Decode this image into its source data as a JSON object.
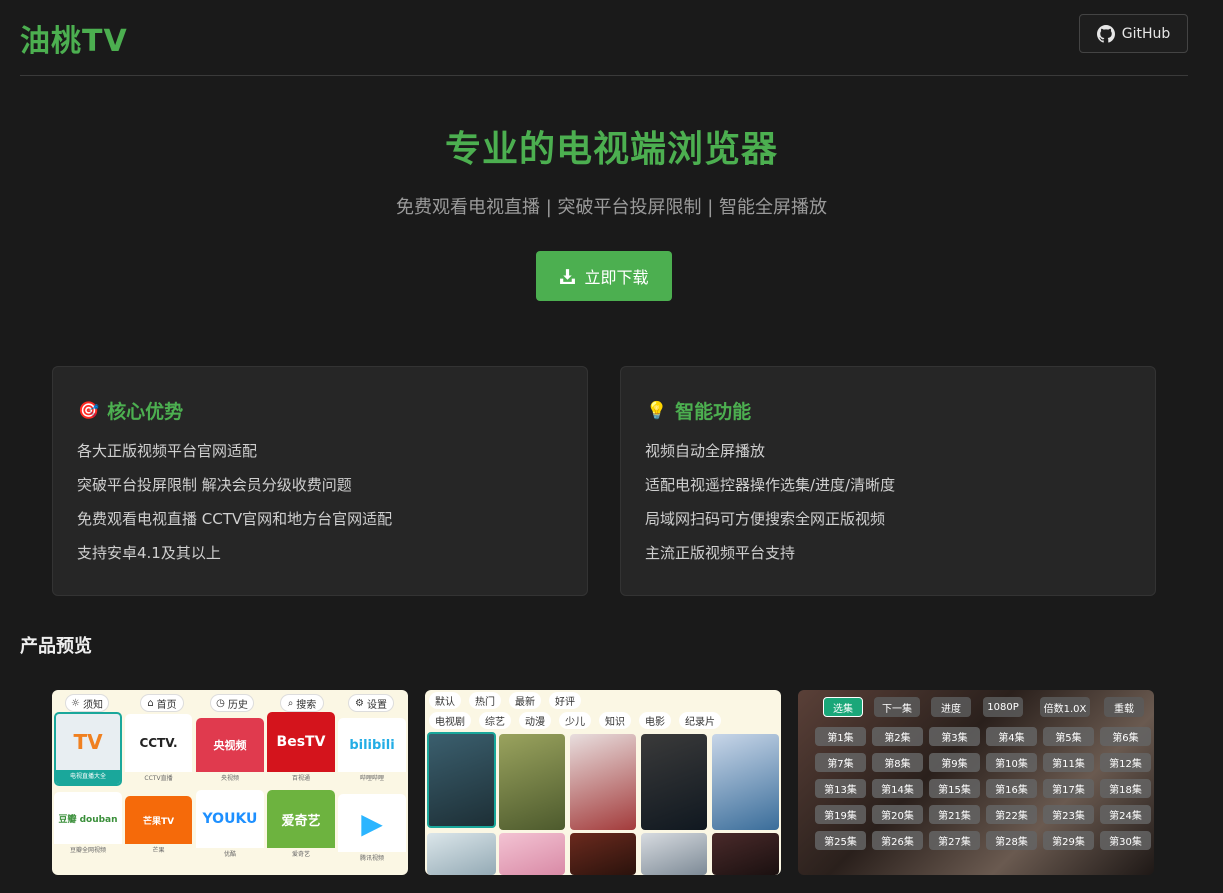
{
  "header": {
    "logo": "油桃TV",
    "github_label": "GitHub"
  },
  "hero": {
    "title": "专业的电视端浏览器",
    "subtitle": "免费观看电视直播 | 突破平台投屏限制 | 智能全屏播放",
    "download_label": "立即下载"
  },
  "cards": [
    {
      "icon": "🎯",
      "title": "核心优势",
      "items": [
        "各大正版视频平台官网适配",
        "突破平台投屏限制 解决会员分级收费问题",
        "免费观看电视直播 CCTV官网和地方台官网适配",
        "支持安卓4.1及其以上"
      ]
    },
    {
      "icon": "💡",
      "title": "智能功能",
      "items": [
        "视频自动全屏播放",
        "适配电视遥控器操作选集/进度/清晰度",
        "局域网扫码可方便搜索全网正版视频",
        "主流正版视频平台支持"
      ]
    }
  ],
  "preview": {
    "title": "产品预览",
    "shot1": {
      "nav": [
        "须知",
        "首页",
        "历史",
        "搜索",
        "设置"
      ],
      "tiles": [
        {
          "art": "TV",
          "cap": "电视直播大全",
          "bg": "#e8eef2"
        },
        {
          "art": "CCTV.",
          "cap": "CCTV直播",
          "bg": "#ffffff"
        },
        {
          "art": "央视频",
          "cap": "央视频",
          "bg": "#e03a4e"
        },
        {
          "art": "BesTV",
          "cap": "百视通",
          "bg": "#d4141c"
        },
        {
          "art": "bilibili",
          "cap": "哔哩哔哩",
          "bg": "#ffffff"
        },
        {
          "art": "豆瓣 douban",
          "cap": "豆瓣全网视频",
          "bg": "#ffffff"
        },
        {
          "art": "芒果TV",
          "cap": "芒果",
          "bg": "#f56a0a"
        },
        {
          "art": "YOUKU",
          "cap": "优酷",
          "bg": "#ffffff"
        },
        {
          "art": "爱奇艺",
          "cap": "爱奇艺",
          "bg": "#6db33f"
        },
        {
          "art": "▶",
          "cap": "腾讯视频",
          "bg": "#ffffff"
        }
      ]
    },
    "shot2": {
      "row1": [
        "默认",
        "热门",
        "最新",
        "好评"
      ],
      "row2": [
        "电视剧",
        "综艺",
        "动漫",
        "少儿",
        "知识",
        "电影",
        "纪录片"
      ]
    },
    "shot3": {
      "controls": [
        "选集",
        "下一集",
        "进度",
        "1080P",
        "倍数1.0X",
        "重载"
      ],
      "episodes": [
        "第1集",
        "第2集",
        "第3集",
        "第4集",
        "第5集",
        "第6集",
        "第7集",
        "第8集",
        "第9集",
        "第10集",
        "第11集",
        "第12集",
        "第13集",
        "第14集",
        "第15集",
        "第16集",
        "第17集",
        "第18集",
        "第19集",
        "第20集",
        "第21集",
        "第22集",
        "第23集",
        "第24集",
        "第25集",
        "第26集",
        "第27集",
        "第28集",
        "第29集",
        "第30集"
      ]
    }
  }
}
